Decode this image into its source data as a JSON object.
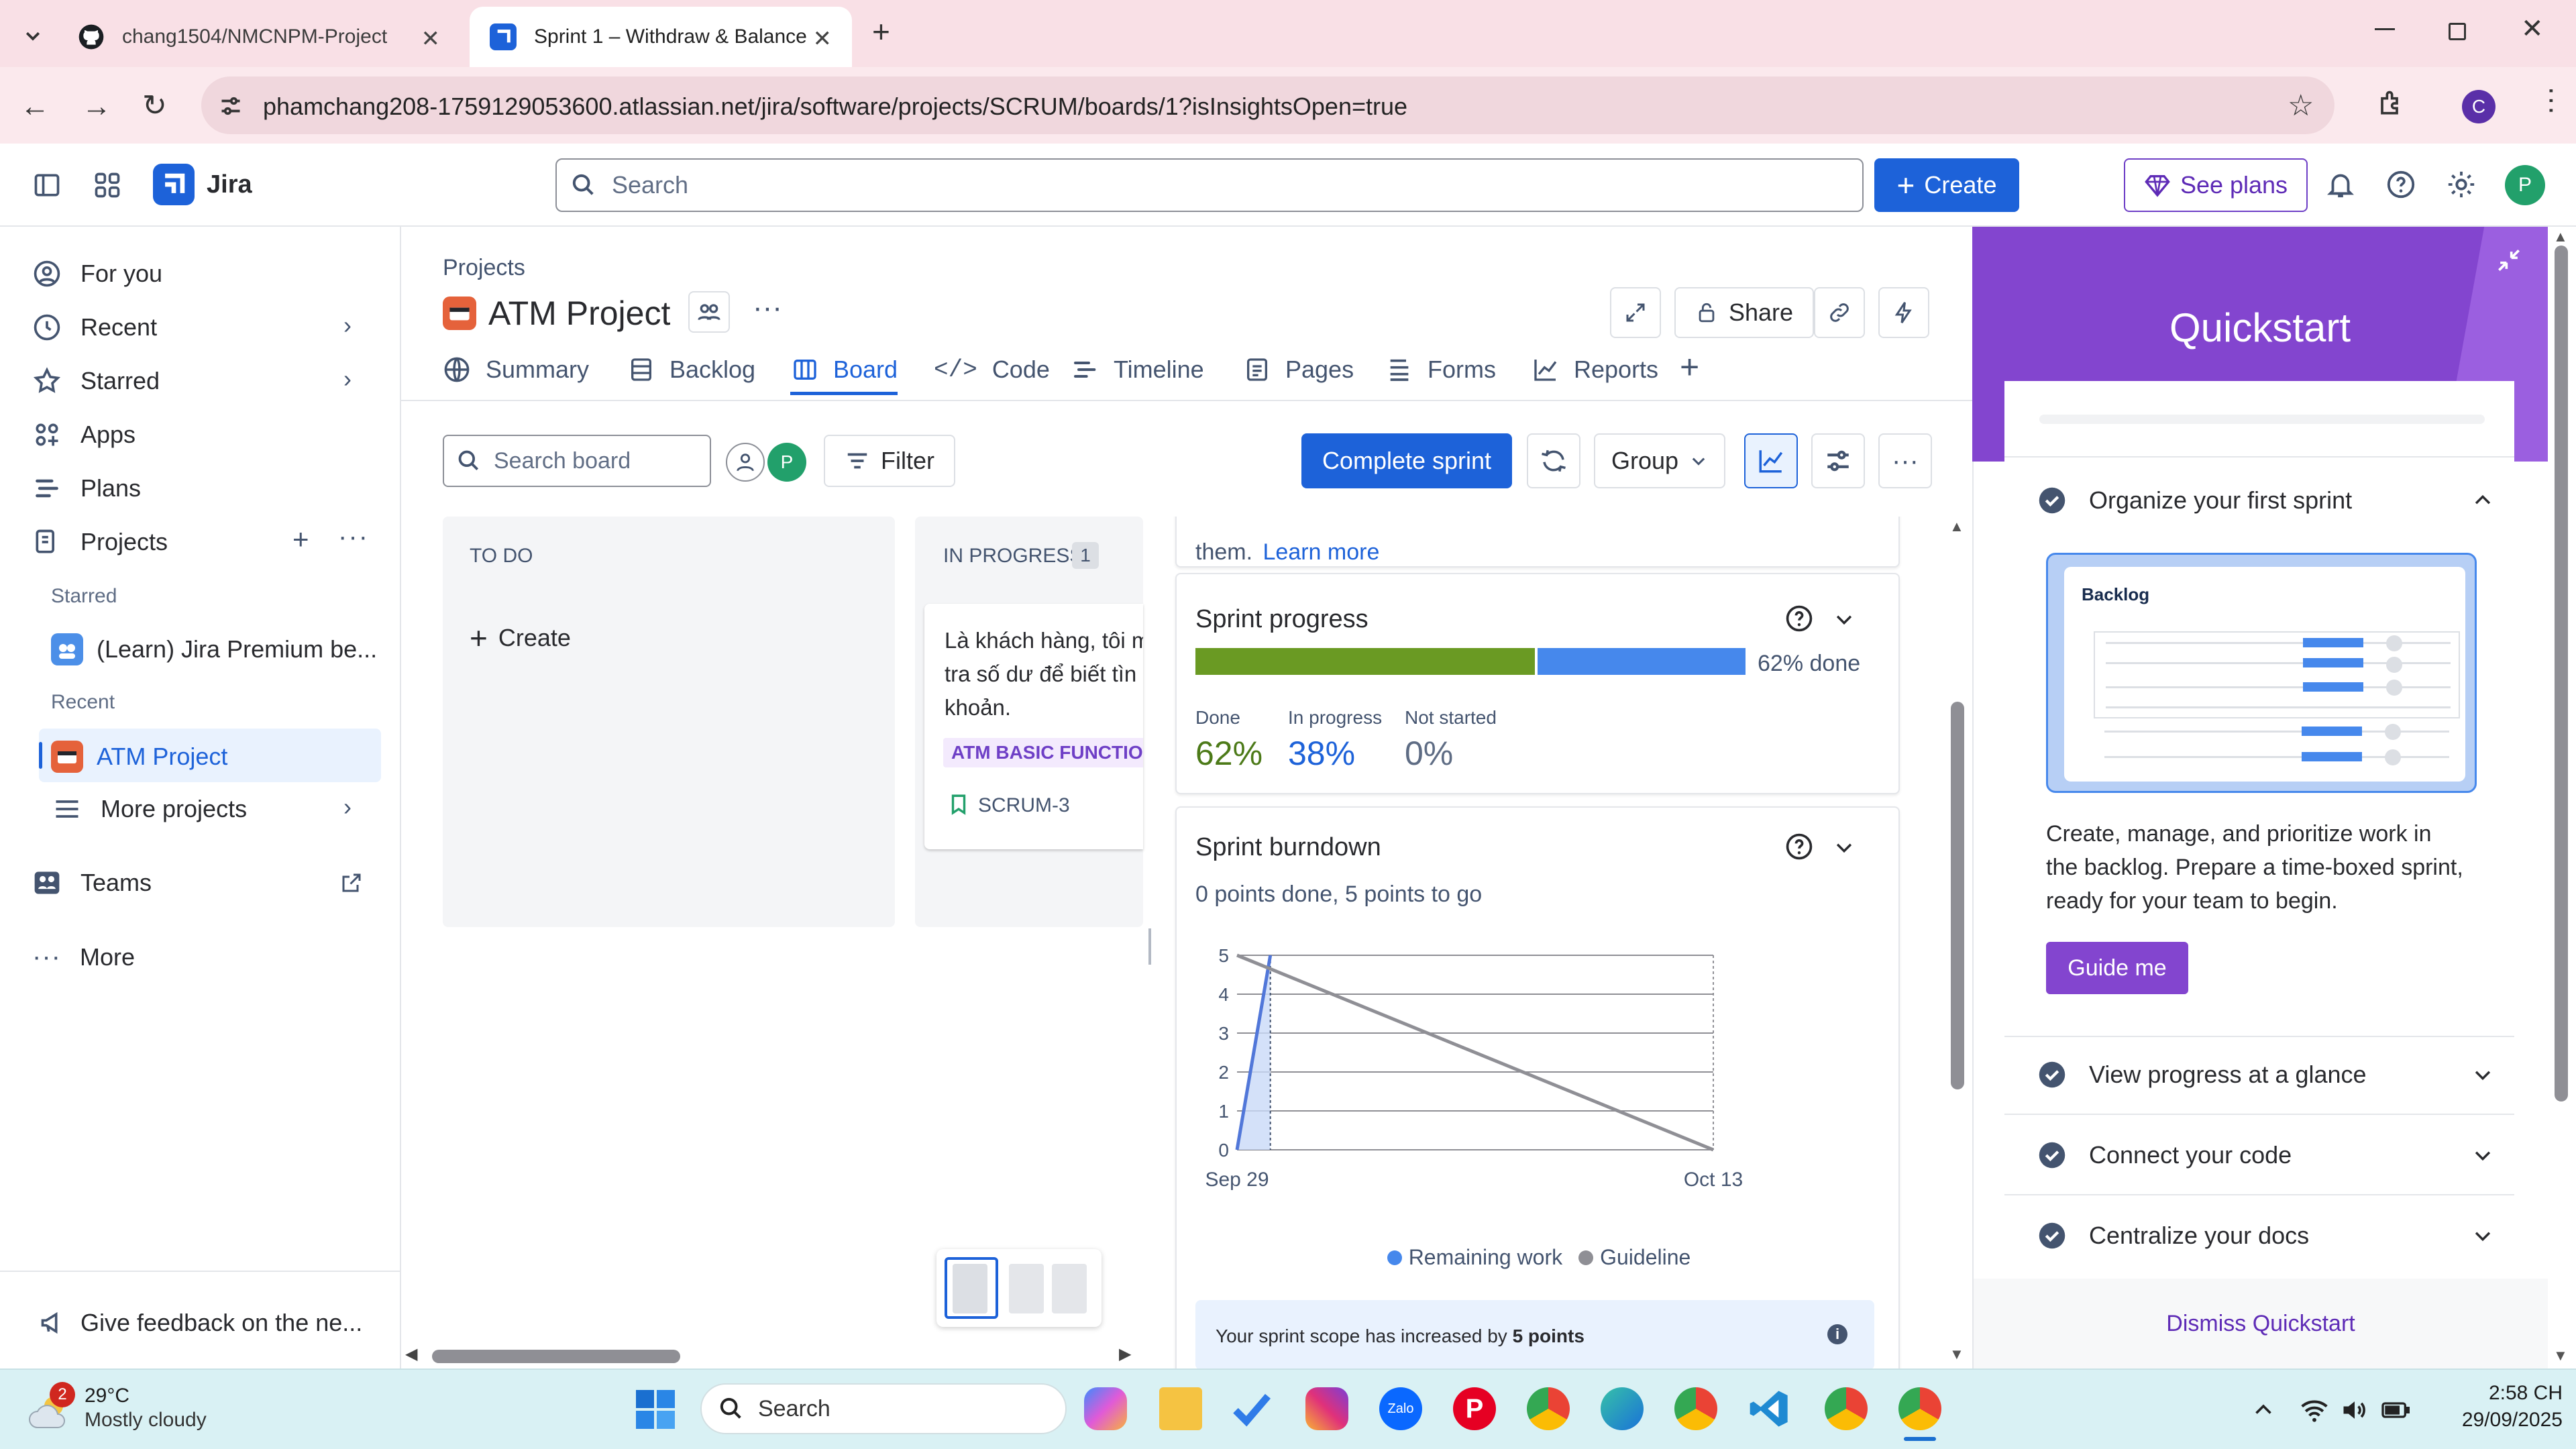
{
  "browser": {
    "tabs": [
      {
        "title": "chang1504/NMCNPM-Project",
        "active": false
      },
      {
        "title": "Sprint 1 – Withdraw & Balance",
        "active": true
      }
    ],
    "url": "phamchang208-1759129053600.atlassian.net/jira/software/projects/SCRUM/boards/1?isInsightsOpen=true",
    "profile_initial": "C"
  },
  "topnav": {
    "product": "Jira",
    "search_placeholder": "Search",
    "create_label": "Create",
    "see_plans_label": "See plans",
    "avatar_initial": "P"
  },
  "sidebar": {
    "items": [
      {
        "label": "For you"
      },
      {
        "label": "Recent"
      },
      {
        "label": "Starred"
      },
      {
        "label": "Apps"
      },
      {
        "label": "Plans"
      },
      {
        "label": "Projects"
      }
    ],
    "starred_heading": "Starred",
    "starred_item": "(Learn) Jira Premium be...",
    "recent_heading": "Recent",
    "recent_item": "ATM Project",
    "more_projects": "More projects",
    "teams": "Teams",
    "more": "More",
    "feedback": "Give feedback on the ne..."
  },
  "project": {
    "breadcrumb": "Projects",
    "title": "ATM Project",
    "share_label": "Share",
    "tabs": [
      "Summary",
      "Backlog",
      "Board",
      "Code",
      "Timeline",
      "Pages",
      "Forms",
      "Reports"
    ],
    "active_tab": "Board"
  },
  "board": {
    "search_placeholder": "Search board",
    "filter_label": "Filter",
    "complete_sprint_label": "Complete sprint",
    "group_label": "Group",
    "avatar_initial": "P",
    "columns": [
      {
        "title": "TO DO",
        "count": "",
        "create_label": "Create"
      },
      {
        "title": "IN PROGRESS",
        "count": "1"
      }
    ],
    "card": {
      "line1": "Là khách hàng, tôi m",
      "line2": "tra số dư để biết tìn",
      "line3": "khoản.",
      "epic": "ATM BASIC FUNCTIOI",
      "key": "SCRUM-3"
    }
  },
  "insights": {
    "top_text": "them.",
    "learn_more": "Learn more",
    "progress": {
      "title": "Sprint progress",
      "done_label": "62% done",
      "done_pct": 62,
      "inprog_pct": 38,
      "stats": [
        {
          "label": "Done",
          "value": "62%",
          "color": "#4c7a18"
        },
        {
          "label": "In progress",
          "value": "38%",
          "color": "#1d62d9"
        },
        {
          "label": "Not started",
          "value": "0%",
          "color": "#5e6c84"
        }
      ]
    },
    "burndown": {
      "title": "Sprint burndown",
      "subtitle": "0 points done, 5 points to go",
      "legend_remaining": "Remaining work",
      "legend_guideline": "Guideline",
      "scope_text_prefix": "Your sprint scope has increased by",
      "scope_text_bold": "5 points"
    }
  },
  "chart_data": {
    "type": "line",
    "title": "Sprint burndown",
    "x_labels": [
      "Sep 29",
      "Oct 13"
    ],
    "ylim": [
      0,
      5
    ],
    "yticks": [
      0,
      1,
      2,
      3,
      4,
      5
    ],
    "series": [
      {
        "name": "Remaining work",
        "color": "#5177d9",
        "points": [
          [
            0,
            0
          ],
          [
            0.07,
            5
          ]
        ]
      },
      {
        "name": "Guideline",
        "color": "#8f8f95",
        "points": [
          [
            0,
            5
          ],
          [
            1,
            0
          ]
        ]
      }
    ]
  },
  "quickstart": {
    "title": "Quickstart",
    "sections": [
      {
        "label": "Organize your first sprint",
        "expanded": true
      },
      {
        "label": "View progress at a glance",
        "expanded": false
      },
      {
        "label": "Connect your code",
        "expanded": false
      },
      {
        "label": "Centralize your docs",
        "expanded": false
      }
    ],
    "illustration_title": "Backlog",
    "description": [
      "Create, manage, and prioritize work in",
      "the backlog. Prepare a time-boxed sprint,",
      "ready for your team to begin."
    ],
    "guide_button": "Guide me",
    "dismiss": "Dismiss Quickstart"
  },
  "taskbar": {
    "weather_temp": "29°C",
    "weather_desc": "Mostly cloudy",
    "weather_badge": "2",
    "search_placeholder": "Search",
    "time": "2:58 CH",
    "date": "29/09/2025"
  }
}
